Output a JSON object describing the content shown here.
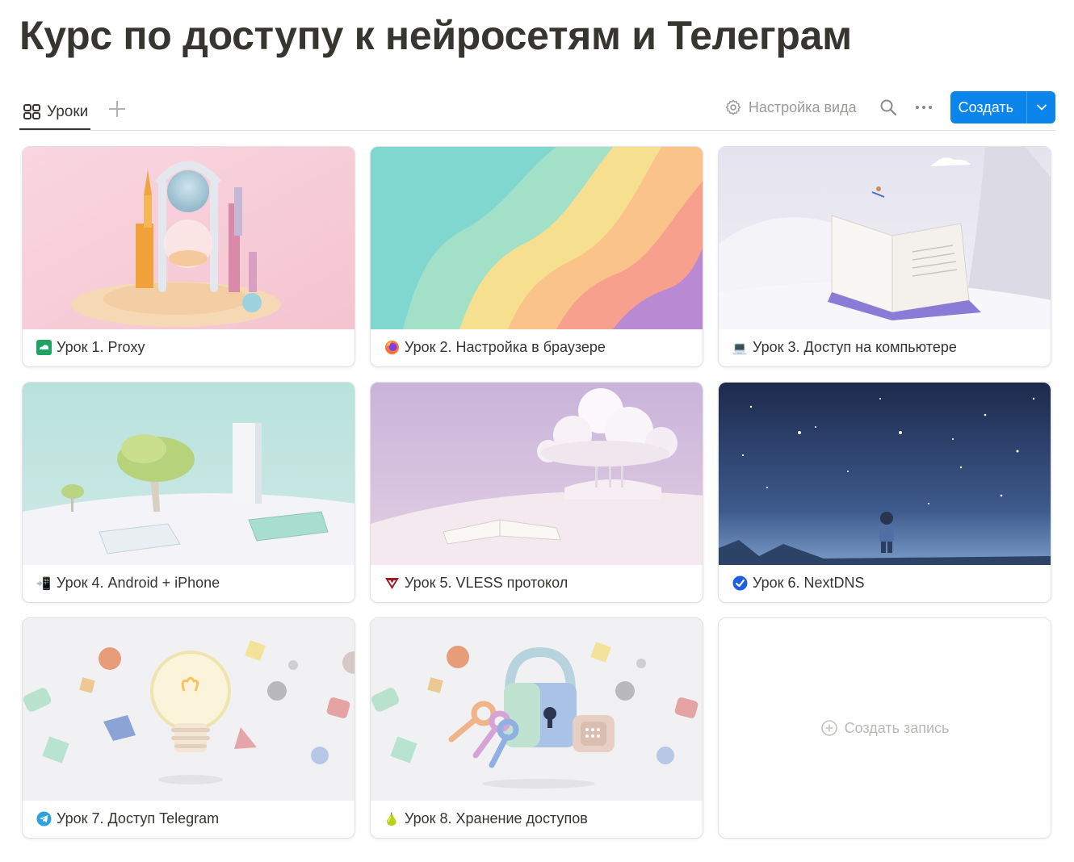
{
  "page": {
    "title": "Курс по доступу к нейросетям и Телеграм"
  },
  "views": [
    {
      "label": "Уроки",
      "icon": "gallery-grid-icon",
      "active": true
    }
  ],
  "toolbar": {
    "settings_label": "Настройка вида",
    "settings_icon": "gear-icon",
    "search_icon": "search-icon",
    "more_icon": "more-dots-icon",
    "create_label": "Создать",
    "accent": "#0b84ec"
  },
  "cards": [
    {
      "emoji": "proxy-cloud-icon",
      "title": "Урок 1. Proxy"
    },
    {
      "emoji": "firefox-icon",
      "title": "Урок 2. Настройка в браузере"
    },
    {
      "emoji": "💻",
      "title": "Урок 3. Доступ на компьютере"
    },
    {
      "emoji": "📲",
      "title": "Урок 4. Android + iPhone"
    },
    {
      "emoji": "vless-v-icon",
      "title": "Урок 5. VLESS протокол"
    },
    {
      "emoji": "nextdns-check-icon",
      "title": "Урок 6. NextDNS"
    },
    {
      "emoji": "telegram-icon",
      "title": "Урок 7. Доступ Telegram"
    },
    {
      "emoji": "🍐",
      "title": "Урок 8. Хранение доступов"
    }
  ],
  "new_record": {
    "label": "Создать запись"
  }
}
